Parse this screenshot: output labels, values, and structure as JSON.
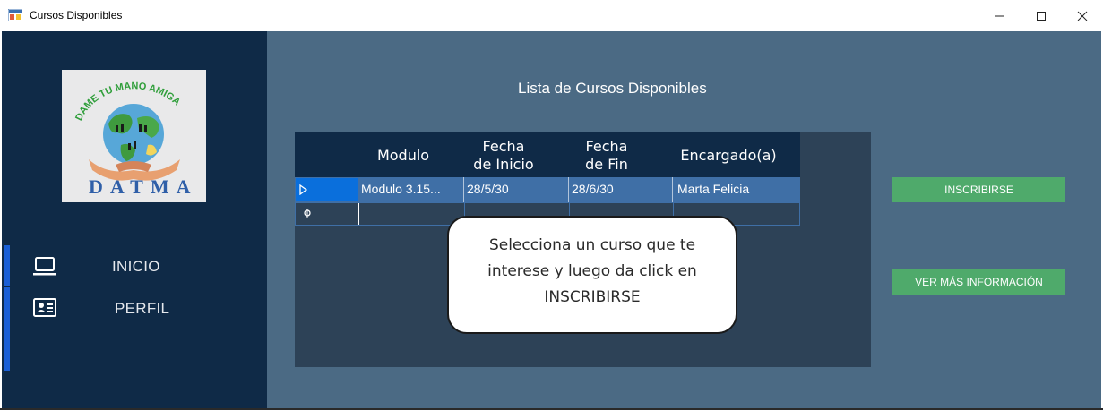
{
  "window": {
    "title": "Cursos Disponibles"
  },
  "logo": {
    "top_text": "DAME TU MANO AMIGA",
    "bottom_text": "DATMA"
  },
  "sidebar": {
    "items": [
      {
        "label": "INICIO",
        "icon": "laptop-icon"
      },
      {
        "label": "PERFIL",
        "icon": "id-card-icon"
      },
      {
        "label": "",
        "icon": ""
      }
    ]
  },
  "main": {
    "heading": "Lista de Cursos Disponibles",
    "grid": {
      "columns": [
        "Modulo",
        "Fecha\nde Inicio",
        "Fecha\nde Fin",
        "Encargado(a)"
      ],
      "rows": [
        {
          "modulo": "Modulo 3.15...",
          "inicio": "28/5/30",
          "fin": "28/6/30",
          "encargado": "Marta Felicia"
        }
      ]
    },
    "tooltip": "Selecciona un curso que te\ninterese y luego da click en\nINSCRIBIRSE"
  },
  "actions": {
    "enroll": "INSCRIBIRSE",
    "more_info": "VER MÁS INFORMACIÓN"
  },
  "colors": {
    "sidebar": "#0f2a47",
    "content": "#4b6a84",
    "accent": "#1a5fd6",
    "button": "#4faa6b",
    "selected_row": "#3f6fa6"
  }
}
